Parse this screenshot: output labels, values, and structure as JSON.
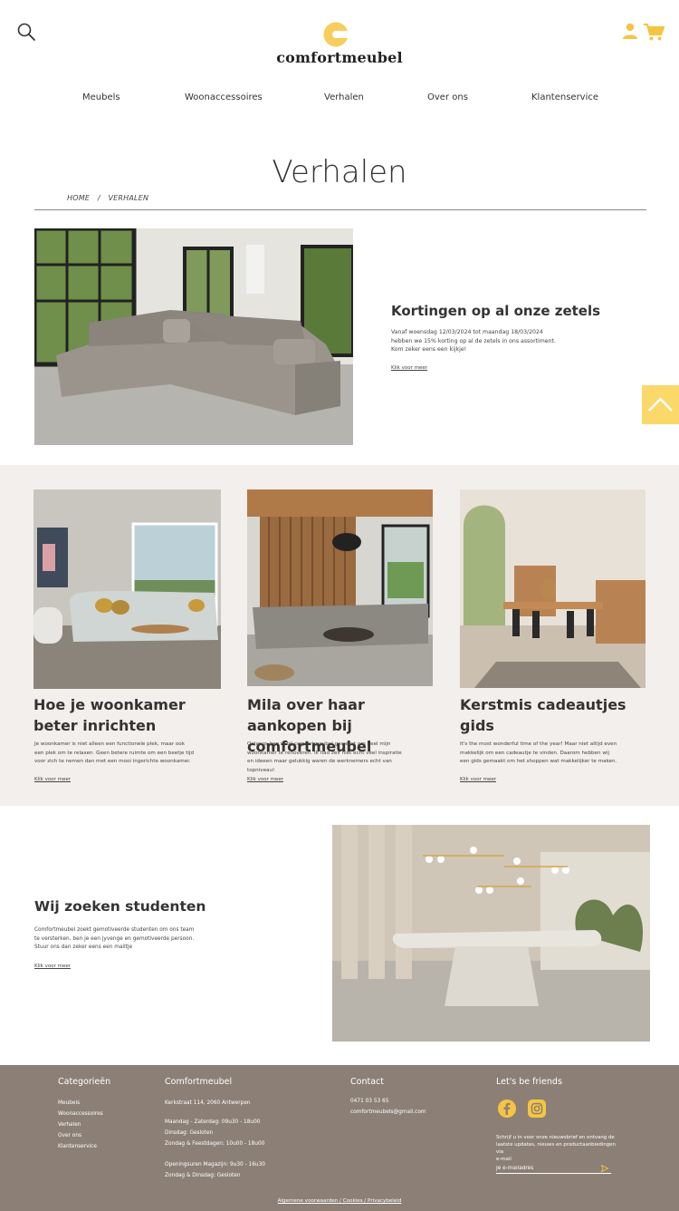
{
  "brand": {
    "name": "comfortmeubel",
    "accent": "#fad86a",
    "footer_bg": "#8c8076",
    "beige_bg": "#f3efec"
  },
  "nav": {
    "items": [
      "Meubels",
      "Woonaccessoires",
      "Verhalen",
      "Over ons",
      "Klantenservice"
    ]
  },
  "page": {
    "title": "Verhalen",
    "breadcrumb": [
      "HOME",
      "/",
      "VERHALEN"
    ]
  },
  "featured": {
    "title": "Kortingen op al onze zetels",
    "lines": [
      "Vanaf woensdag 12/03/2024 tot maandag 18/03/2024",
      "hebben we 15% korting op al de zetels in ons assortiment.",
      "Kom zeker eens een kijkje!"
    ],
    "link": "Klik voor meer"
  },
  "cards": [
    {
      "title": "Hoe je woonkamer beter inrichten",
      "lines": [
        "Je woonkamer is niet alleen een functionele plek, maar ook",
        "een plek om te relaxen. Geen betere ruimte om een beetje tijd",
        "voor zich te nemen dan met een mooi ingerichte woonkamer."
      ],
      "link": "Klik voor meer"
    },
    {
      "title": "Mila over haar aankopen bij comfortmeubel",
      "lines": [
        "Onlangs ben ik bij comfortmeubel geweest om heel mijn",
        "woonkamer te renoveren. Ik had zelf niet echt veel inspiratie",
        "en ideeen maar gelukkig waren de werknemers echt van",
        "topniveau!"
      ],
      "link": "Klik voor meer"
    },
    {
      "title": "Kerstmis cadeautjes gids",
      "lines": [
        "It's the most wonderful time of the year! Maar niet altijd even",
        "makkelijk om een cadeautje te vinden. Daarom hebben wij",
        "een gids gemaakt om het shoppen wat makkelijker te maken."
      ],
      "link": "Klik voor meer"
    }
  ],
  "students": {
    "title": "Wij zoeken studenten",
    "lines": [
      "Comfortmeubel zoekt gemotiveerde studenten om ons team",
      "te versterken. ben je een jyvenge en gemotiveerde persoon.",
      "Stuur ons dan zeker eens een mailtje"
    ],
    "link": "Klik voor meer"
  },
  "footer": {
    "categories": {
      "heading": "Categorieën",
      "items": [
        "Meubels",
        "Woonaccessoires",
        "Verhalen",
        "Over ons",
        "Klantenservice"
      ]
    },
    "company": {
      "heading": "Comfortmeubel",
      "address": "Kerkstraat 114, 2060 Antwerpen",
      "hours": [
        "Maandag - Zaterdag: 09u30 - 18u00",
        "Dinsdag: Gesloten",
        "Zondag & Feestdagen: 10u00 - 18u00"
      ],
      "warehouse": [
        "Openingsuren Magazijn: 9u30 - 16u30",
        "Zondag & Dinsdag: Gesloten"
      ]
    },
    "contact": {
      "heading": "Contact",
      "phone": "0471 03 53 65",
      "email": "comfortmeubels@gmail.com"
    },
    "social": {
      "heading": "Let's be friends",
      "newsletter": [
        "Schrijf u in voor onze nieuwsbrief en ontvang de",
        "laatste updates, nieuws en productaanbiedingen via",
        "e-mail"
      ],
      "email_placeholder": "Je e-mailadres"
    },
    "legal": "Algemene voorwaarden / Cookies / Privacybeleid"
  }
}
